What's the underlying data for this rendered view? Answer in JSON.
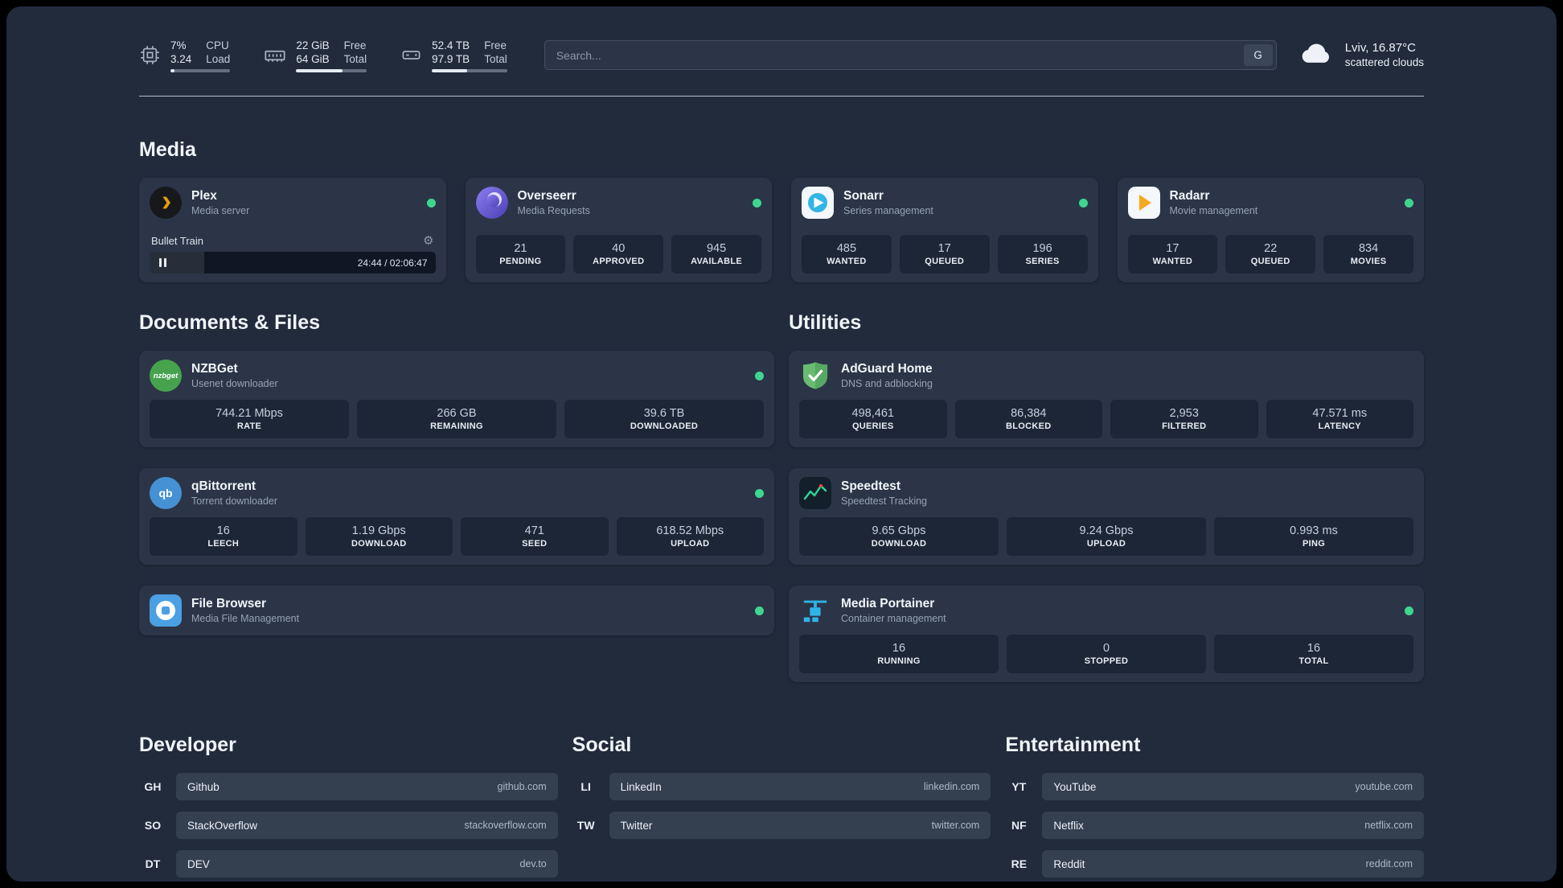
{
  "header": {
    "cpu": {
      "pct": "7%",
      "load": "3.24",
      "label_pct": "CPU",
      "label_load": "Load",
      "bar_pct": 7
    },
    "ram": {
      "free": "22 GiB",
      "total": "64 GiB",
      "label_free": "Free",
      "label_total": "Total",
      "bar_pct": 66
    },
    "disk": {
      "free": "52.4 TB",
      "total": "97.9 TB",
      "label_free": "Free",
      "label_total": "Total",
      "bar_pct": 47
    },
    "search": {
      "placeholder": "Search...",
      "button": "G"
    },
    "weather": {
      "location": "Lviv, 16.87°C",
      "condition": "scattered clouds"
    }
  },
  "media": {
    "title": "Media",
    "plex": {
      "name": "Plex",
      "desc": "Media server",
      "now_playing": "Bullet Train",
      "time": "24:44 / 02:06:47"
    },
    "overseerr": {
      "name": "Overseerr",
      "desc": "Media Requests",
      "stats": [
        {
          "value": "21",
          "label": "PENDING"
        },
        {
          "value": "40",
          "label": "APPROVED"
        },
        {
          "value": "945",
          "label": "AVAILABLE"
        }
      ]
    },
    "sonarr": {
      "name": "Sonarr",
      "desc": "Series management",
      "stats": [
        {
          "value": "485",
          "label": "WANTED"
        },
        {
          "value": "17",
          "label": "QUEUED"
        },
        {
          "value": "196",
          "label": "SERIES"
        }
      ]
    },
    "radarr": {
      "name": "Radarr",
      "desc": "Movie management",
      "stats": [
        {
          "value": "17",
          "label": "WANTED"
        },
        {
          "value": "22",
          "label": "QUEUED"
        },
        {
          "value": "834",
          "label": "MOVIES"
        }
      ]
    }
  },
  "documents": {
    "title": "Documents & Files",
    "nzbget": {
      "name": "NZBGet",
      "desc": "Usenet downloader",
      "logo_text": "nzbget",
      "stats": [
        {
          "value": "744.21 Mbps",
          "label": "RATE"
        },
        {
          "value": "266 GB",
          "label": "REMAINING"
        },
        {
          "value": "39.6 TB",
          "label": "DOWNLOADED"
        }
      ]
    },
    "qbittorrent": {
      "name": "qBittorrent",
      "desc": "Torrent downloader",
      "logo_text": "qb",
      "stats": [
        {
          "value": "16",
          "label": "LEECH"
        },
        {
          "value": "1.19 Gbps",
          "label": "DOWNLOAD"
        },
        {
          "value": "471",
          "label": "SEED"
        },
        {
          "value": "618.52 Mbps",
          "label": "UPLOAD"
        }
      ]
    },
    "filebrowser": {
      "name": "File Browser",
      "desc": "Media File Management"
    }
  },
  "utilities": {
    "title": "Utilities",
    "adguard": {
      "name": "AdGuard Home",
      "desc": "DNS and adblocking",
      "stats": [
        {
          "value": "498,461",
          "label": "QUERIES"
        },
        {
          "value": "86,384",
          "label": "BLOCKED"
        },
        {
          "value": "2,953",
          "label": "FILTERED"
        },
        {
          "value": "47.571 ms",
          "label": "LATENCY"
        }
      ]
    },
    "speedtest": {
      "name": "Speedtest",
      "desc": "Speedtest Tracking",
      "stats": [
        {
          "value": "9.65 Gbps",
          "label": "DOWNLOAD"
        },
        {
          "value": "9.24 Gbps",
          "label": "UPLOAD"
        },
        {
          "value": "0.993 ms",
          "label": "PING"
        }
      ]
    },
    "portainer": {
      "name": "Media Portainer",
      "desc": "Container management",
      "stats": [
        {
          "value": "16",
          "label": "RUNNING"
        },
        {
          "value": "0",
          "label": "STOPPED"
        },
        {
          "value": "16",
          "label": "TOTAL"
        }
      ]
    }
  },
  "bookmarks": {
    "developer": {
      "title": "Developer",
      "items": [
        {
          "abbr": "GH",
          "name": "Github",
          "domain": "github.com"
        },
        {
          "abbr": "SO",
          "name": "StackOverflow",
          "domain": "stackoverflow.com"
        },
        {
          "abbr": "DT",
          "name": "DEV",
          "domain": "dev.to"
        }
      ]
    },
    "social": {
      "title": "Social",
      "items": [
        {
          "abbr": "LI",
          "name": "LinkedIn",
          "domain": "linkedin.com"
        },
        {
          "abbr": "TW",
          "name": "Twitter",
          "domain": "twitter.com"
        }
      ]
    },
    "entertainment": {
      "title": "Entertainment",
      "items": [
        {
          "abbr": "YT",
          "name": "YouTube",
          "domain": "youtube.com"
        },
        {
          "abbr": "NF",
          "name": "Netflix",
          "domain": "netflix.com"
        },
        {
          "abbr": "RE",
          "name": "Reddit",
          "domain": "reddit.com"
        }
      ]
    }
  },
  "colors": {
    "status_ok": "#3fd68f",
    "plex_accent": "#e5a00d",
    "radarr_accent": "#f7a823",
    "sonarr_accent": "#33b5e5",
    "adguard_accent": "#68bc71",
    "portainer_accent": "#2fb3e8"
  }
}
